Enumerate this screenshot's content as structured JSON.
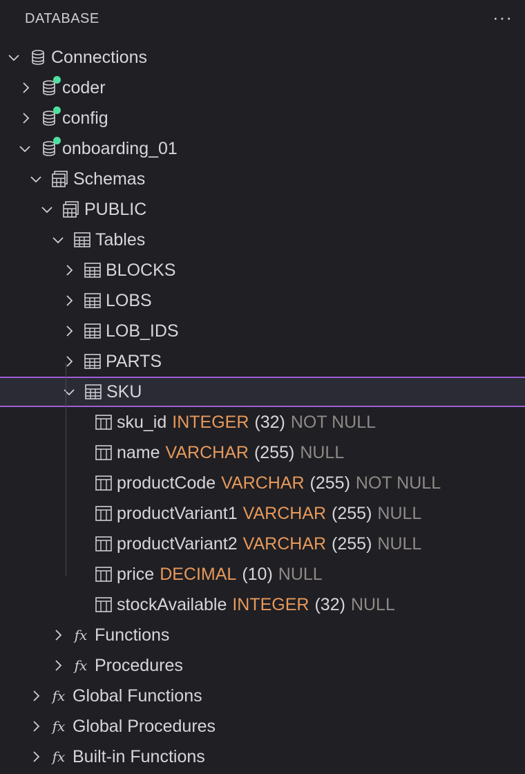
{
  "header": {
    "title": "DATABASE",
    "more_label": "···"
  },
  "tree": {
    "connections": "Connections",
    "coder": "coder",
    "config": "config",
    "onboarding": "onboarding_01",
    "schemas": "Schemas",
    "public": "PUBLIC",
    "tables": "Tables",
    "table_items": [
      "BLOCKS",
      "LOBS",
      "LOB_IDS",
      "PARTS",
      "SKU"
    ],
    "columns": [
      {
        "name": "sku_id",
        "type": "INTEGER",
        "len": "(32)",
        "nullability": "NOT NULL"
      },
      {
        "name": "name",
        "type": "VARCHAR",
        "len": "(255)",
        "nullability": "NULL"
      },
      {
        "name": "productCode",
        "type": "VARCHAR",
        "len": "(255)",
        "nullability": "NOT NULL"
      },
      {
        "name": "productVariant1",
        "type": "VARCHAR",
        "len": "(255)",
        "nullability": "NULL"
      },
      {
        "name": "productVariant2",
        "type": "VARCHAR",
        "len": "(255)",
        "nullability": "NULL"
      },
      {
        "name": "price",
        "type": "DECIMAL",
        "len": "(10)",
        "nullability": "NULL"
      },
      {
        "name": "stockAvailable",
        "type": "INTEGER",
        "len": "(32)",
        "nullability": "NULL"
      }
    ],
    "functions": "Functions",
    "procedures": "Procedures",
    "global_functions": "Global Functions",
    "global_procedures": "Global Procedures",
    "builtin_functions": "Built-in Functions",
    "fx_glyph": "fx"
  },
  "colors": {
    "background": "#1f1f24",
    "type": "#e7995a",
    "nullability": "#8f8a86",
    "status": "#4fe0a0",
    "selection_border": "#a05dd6"
  }
}
